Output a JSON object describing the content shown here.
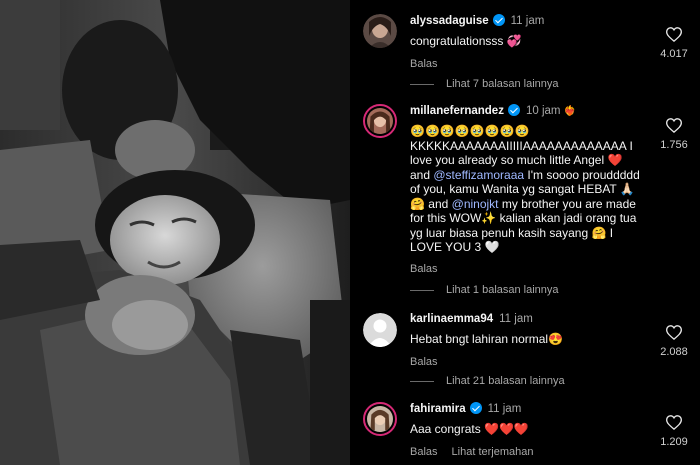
{
  "comments": [
    {
      "username": "alyssadaguise",
      "verified": true,
      "time": "11 jam",
      "text_plain": "congratulationsss 💞",
      "reply_label": "Balas",
      "likes": "4.017"
    },
    {
      "username": "millanefernandez",
      "verified": true,
      "time": "10 jam",
      "time_emoji": "❤️‍🔥",
      "text_emoji_row": "🥹🥹🥹🥹🥹🥹🥹🥹",
      "text_1": "KKKKKAAAAAAAIIIIIAAAAAAAAAAAAA I love you already so much little Angel ❤️ and",
      "mention_1": "@steffizamoraaa",
      "text_2": "I'm soooo prouddddd of you, kamu Wanita yg sangat  HEBAT 🙏🏻🤗 and",
      "mention_2": "@ninojkt",
      "text_3": "my brother you are made for this WOW✨ kalian akan jadi orang tua yg luar biasa penuh kasih sayang 🤗 I LOVE YOU 3 🤍",
      "reply_label": "Balas",
      "likes": "1.756"
    },
    {
      "username": "karlinaemma94",
      "verified": false,
      "time": "11 jam",
      "text_plain": "Hebat bngt lahiran normal😍",
      "reply_label": "Balas",
      "likes": "2.088"
    },
    {
      "username": "fahiramira",
      "verified": true,
      "time": "11 jam",
      "text_plain": "Aaa congrats ❤️❤️❤️",
      "reply_label": "Balas",
      "translate_label": "Lihat terjemahan",
      "likes": "1.209"
    }
  ],
  "view_replies": [
    "Lihat 7 balasan lainnya",
    "Lihat 1 balasan lainnya",
    "Lihat 21 balasan lainnya"
  ],
  "icons": {
    "like": "heart-outline-icon",
    "verified": "verified-badge-icon",
    "default_avatar": "user-silhouette-icon"
  },
  "colors": {
    "background": "#000000",
    "text": "#f5f5f5",
    "secondary": "#a8a8a8",
    "mention": "#9fb8ff",
    "verified": "#0095f6"
  }
}
